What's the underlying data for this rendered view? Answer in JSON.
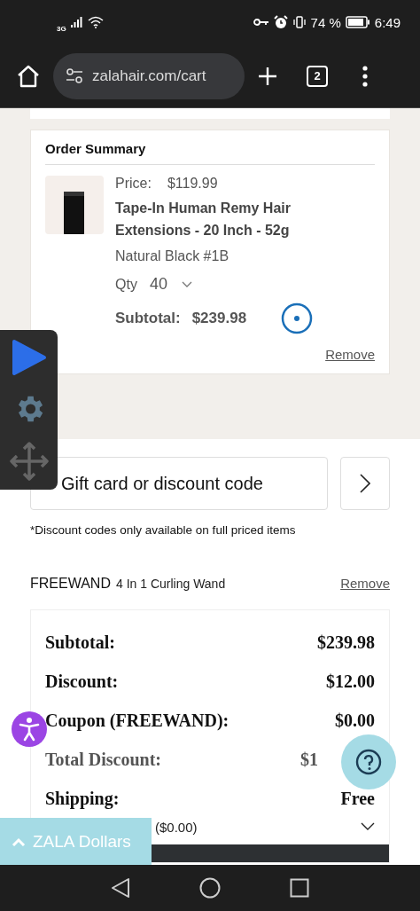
{
  "status_bar": {
    "network": "3G",
    "battery": "74 %",
    "time": "6:49"
  },
  "browser": {
    "url": "zalahair.com/cart",
    "tab_count": "2"
  },
  "order_summary": {
    "title": "Order Summary",
    "item": {
      "price_label": "Price:",
      "price": "$119.99",
      "name": "Tape-In Human Remy Hair Extensions - 20 Inch - 52g",
      "variant": "Natural Black #1B",
      "qty_label": "Qty",
      "qty": "40",
      "subtotal_label": "Subtotal:",
      "subtotal": "$239.98",
      "remove": "Remove"
    }
  },
  "discount": {
    "placeholder": "Gift card or discount code",
    "note": "*Discount codes only available on full priced items"
  },
  "applied_coupon": {
    "code": "FREEWAND",
    "description": "4 In 1 Curling Wand",
    "remove": "Remove"
  },
  "totals": [
    {
      "label": "Subtotal:",
      "value": "$239.98",
      "muted": false
    },
    {
      "label": "Discount:",
      "value": "$12.00",
      "muted": false
    },
    {
      "label": "Coupon (FREEWAND):",
      "value": "$0.00",
      "muted": false
    },
    {
      "label": "Total Discount:",
      "value": "$1",
      "muted": true
    },
    {
      "label": "Shipping:",
      "value": "Free",
      "muted": false
    }
  ],
  "shipping_option": "($0.00)",
  "zala_dollars": "ZALA Dollars"
}
